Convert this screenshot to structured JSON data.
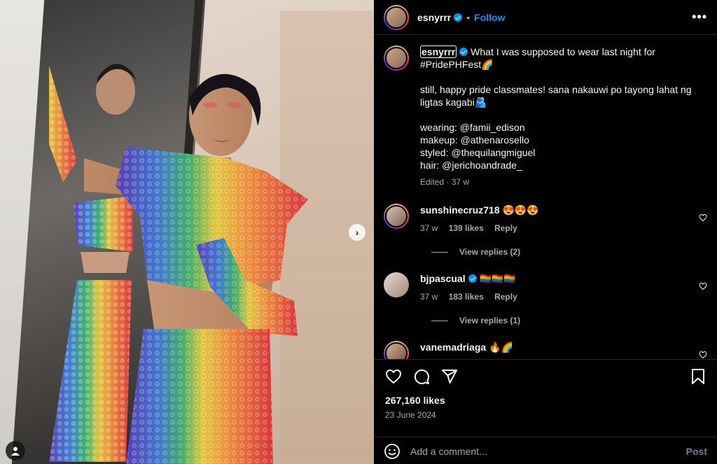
{
  "post": {
    "image_alt": "Person in rainbow jewel-encrusted outfit posing beside a mirror"
  },
  "header": {
    "username": "esnyrrr",
    "follow_label": "Follow",
    "more_label": "•••"
  },
  "caption": {
    "username": "esnyrrr",
    "line1": "What I was supposed to wear last night for",
    "line2": "#PridePHFest🌈",
    "paragraph": "still, happy pride classmates! sana nakauwi po tayong lahat ng ligtas kagabi🫂",
    "credits": [
      "wearing: @famii_edison",
      "makeup: @athenarosello",
      "styled: @thequilangmiguel",
      "hair: @jerichoandrade_"
    ],
    "meta": "Edited · 37 w"
  },
  "comments": [
    {
      "username": "sunshinecruz718",
      "text": "😍😍😍",
      "time": "37 w",
      "likes": "139 likes",
      "reply_label": "Reply",
      "replies_label": "View replies (2)",
      "verified": false
    },
    {
      "username": "bjpascual",
      "text": "🏳️‍🌈🏳️‍🌈🏳️‍🌈",
      "time": "37 w",
      "likes": "183 likes",
      "reply_label": "Reply",
      "replies_label": "View replies (1)",
      "verified": true
    },
    {
      "username": "vanemadriaga",
      "text": "🔥🌈"
    }
  ],
  "footer": {
    "likes": "267,160 likes",
    "date": "23 June 2024",
    "comment_placeholder": "Add a comment...",
    "post_label": "Post"
  },
  "icons": {
    "like": "heart-icon",
    "comment": "comment-icon",
    "share": "share-icon",
    "save": "bookmark-icon",
    "emoji": "emoji-icon",
    "next": "chevron-right-icon",
    "tag": "user-tag-icon"
  },
  "colors": {
    "accent": "#0095f6",
    "background": "#000000",
    "muted": "#a8a8a8"
  }
}
